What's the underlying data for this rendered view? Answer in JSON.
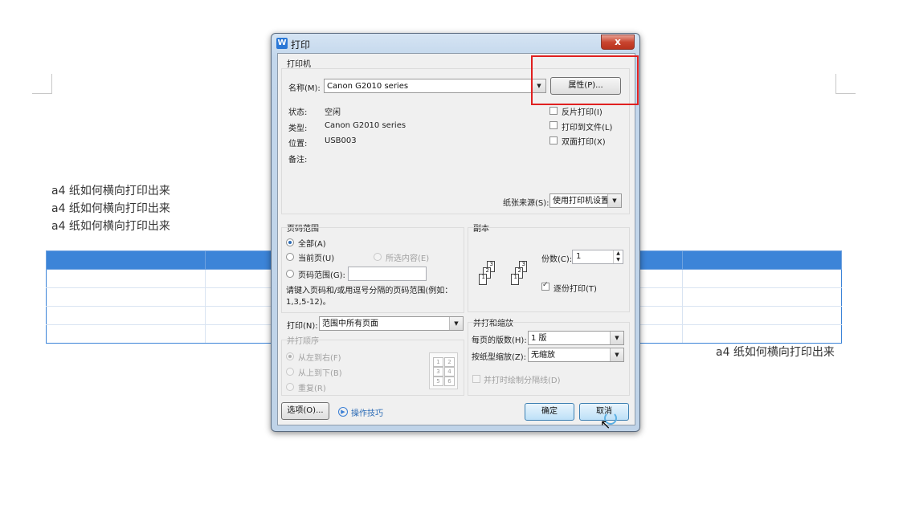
{
  "document": {
    "text_lines": [
      "a4 纸如何横向打印出来",
      "a4 纸如何横向打印出来",
      "a4 纸如何横向打印出来"
    ],
    "right_text": "a4 纸如何横向打印出来",
    "header_color": "#3c84d8"
  },
  "dialog": {
    "title": "打印",
    "close_label": "x",
    "printer": {
      "group_label": "打印机",
      "name_label": "名称(M):",
      "name_value": "Canon G2010 series",
      "properties_button": "属性(P)...",
      "status_label": "状态:",
      "status_value": "空闲",
      "type_label": "类型:",
      "type_value": "Canon G2010 series",
      "location_label": "位置:",
      "location_value": "USB003",
      "comment_label": "备注:",
      "reverse_print": "反片打印(I)",
      "print_to_file": "打印到文件(L)",
      "duplex": "双面打印(X)",
      "paper_source_label": "纸张来源(S):",
      "paper_source_value": "使用打印机设置"
    },
    "page_range": {
      "group_label": "页码范围",
      "all": "全部(A)",
      "current": "当前页(U)",
      "selection": "所选内容(E)",
      "pages": "页码范围(G):",
      "pages_value": "",
      "hint": "请键入页码和/或用逗号分隔的页码范围(例如：1,3,5-12)。",
      "print_label": "打印(N):",
      "print_value": "范围中所有页面",
      "order_label": "并打顺序",
      "left_to_right": "从左到右(F)",
      "top_to_bottom": "从上到下(B)",
      "repeat": "重复(R)"
    },
    "copies": {
      "group_label": "副本",
      "count_label": "份数(C):",
      "count_value": "1",
      "collate": "逐份打印(T)"
    },
    "zoom": {
      "group_label": "并打和缩放",
      "pages_per_sheet_label": "每页的版数(H):",
      "pages_per_sheet_value": "1 版",
      "scale_label": "按纸型缩放(Z):",
      "scale_value": "无缩放",
      "draw_borders": "并打时绘制分隔线(D)"
    },
    "footer": {
      "options_button": "选项(O)...",
      "tips_link": "操作技巧",
      "ok_button": "确定",
      "cancel_button": "取消"
    }
  }
}
